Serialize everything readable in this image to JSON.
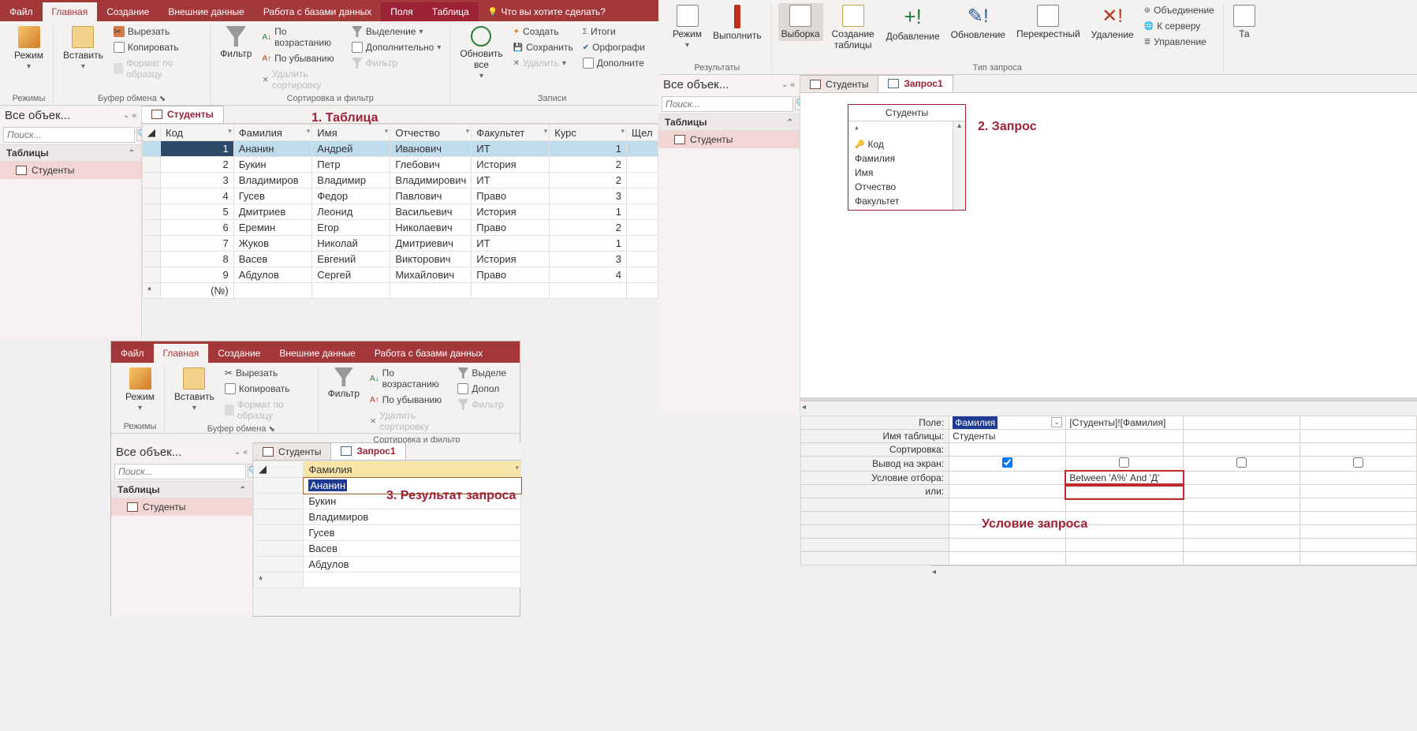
{
  "tabs_main": [
    "Файл",
    "Главная",
    "Создание",
    "Внешние данные",
    "Работа с базами данных",
    "Поля",
    "Таблица"
  ],
  "active_tab_main": "Главная",
  "tell_me": "Что вы хотите сделать?",
  "ribbon": {
    "mode": "Режим",
    "modes_label": "Режимы",
    "paste": "Вставить",
    "cut": "Вырезать",
    "copy": "Копировать",
    "formatp": "Формат по образцу",
    "clipboard_label": "Буфер обмена",
    "filter": "Фильтр",
    "asc": "По возрастанию",
    "desc": "По убыванию",
    "clearsort": "Удалить сортировку",
    "selection": "Выделение",
    "advanced": "Дополнительно",
    "filter_btn": "Фильтр",
    "sort_label": "Сортировка и фильтр",
    "refresh": "Обновить все",
    "new": "Создать",
    "save": "Сохранить",
    "delete": "Удалить",
    "totals": "Итоги",
    "spell": "Орфографи",
    "more": "Дополните",
    "records_label": "Записи"
  },
  "ribbon_q": {
    "mode": "Режим",
    "run": "Выполнить",
    "results_label": "Результаты",
    "select": "Выборка",
    "maketable": "Создание таблицы",
    "append": "Добавление",
    "update": "Обновление",
    "crosstab": "Перекрестный",
    "deleteq": "Удаление",
    "union": "Объединение",
    "passthrough": "К серверу",
    "datadef": "Управление",
    "qtype_label": "Тип запроса",
    "ta": "Та"
  },
  "nav": {
    "title": "Все объек...",
    "search": "Поиск...",
    "tables": "Таблицы",
    "item": "Студенты"
  },
  "table_tab": "Студенты",
  "query_tab": "Запрос1",
  "annot1": "1. Таблица",
  "annot2": "2. Запрос",
  "annot3": "3. Результат запроса",
  "annot4": "Условие запроса",
  "columns": [
    "Код",
    "Фамилия",
    "Имя",
    "Отчество",
    "Факультет",
    "Курс",
    "Щел"
  ],
  "rows": [
    {
      "k": 1,
      "f": "Ананин",
      "i": "Андрей",
      "o": "Иванович",
      "fac": "ИТ",
      "c": 1
    },
    {
      "k": 2,
      "f": "Букин",
      "i": "Петр",
      "o": "Глебович",
      "fac": "История",
      "c": 2
    },
    {
      "k": 3,
      "f": "Владимиров",
      "i": "Владимир",
      "o": "Владимирович",
      "fac": "ИТ",
      "c": 2
    },
    {
      "k": 4,
      "f": "Гусев",
      "i": "Федор",
      "o": "Павлович",
      "fac": "Право",
      "c": 3
    },
    {
      "k": 5,
      "f": "Дмитриев",
      "i": "Леонид",
      "o": "Васильевич",
      "fac": "История",
      "c": 1
    },
    {
      "k": 6,
      "f": "Еремин",
      "i": "Егор",
      "o": "Николаевич",
      "fac": "Право",
      "c": 2
    },
    {
      "k": 7,
      "f": "Жуков",
      "i": "Николай",
      "o": "Дмитриевич",
      "fac": "ИТ",
      "c": 1
    },
    {
      "k": 8,
      "f": "Васев",
      "i": "Евгений",
      "o": "Викторович",
      "fac": "История",
      "c": 3
    },
    {
      "k": 9,
      "f": "Абдулов",
      "i": "Сергей",
      "o": "Михайлович",
      "fac": "Право",
      "c": 4
    }
  ],
  "newrow_placeholder": "(№)",
  "qbox": {
    "title": "Студенты",
    "fields": [
      "*",
      "Код",
      "Фамилия",
      "Имя",
      "Отчество",
      "Факультет"
    ]
  },
  "qgrid": {
    "labels": {
      "field": "Поле:",
      "table": "Имя таблицы:",
      "sort": "Сортировка:",
      "show": "Вывод на экран:",
      "criteria": "Условие отбора:",
      "or": "или:"
    },
    "field1": "Фамилия",
    "field2": "[Студенты]![Фамилия]",
    "table1": "Студенты",
    "criteria2": "Between 'А%' And 'Д'"
  },
  "tabs_result": [
    "Файл",
    "Главная",
    "Создание",
    "Внешние данные",
    "Работа с базами данных"
  ],
  "result_col": "Фамилия",
  "result_rows": [
    "Ананин",
    "Букин",
    "Владимиров",
    "Гусев",
    "Васев",
    "Абдулов"
  ]
}
